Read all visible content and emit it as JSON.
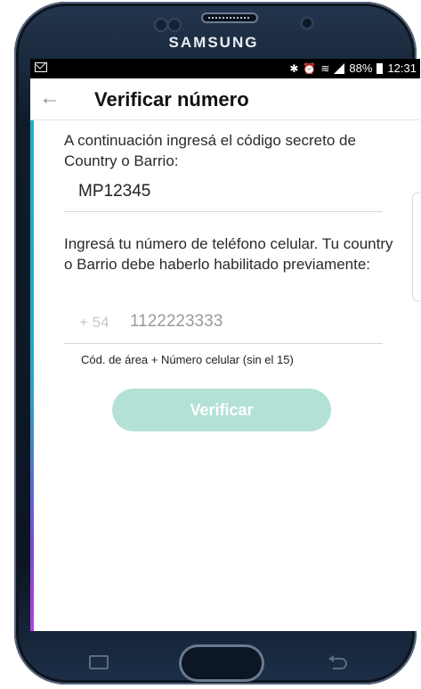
{
  "device": {
    "brand": "SAMSUNG"
  },
  "status_bar": {
    "battery": "88%",
    "time": "12:31"
  },
  "app_bar": {
    "title": "Verificar número",
    "back_icon": "arrow-left-icon"
  },
  "form": {
    "code_prompt": "A continuación ingresá el código secreto de Country o Barrio:",
    "code_value": "MP12345",
    "phone_prompt": "Ingresá tu número de teléfono celular. Tu country o Barrio debe haberlo habilitado previamente:",
    "phone_prefix": "+ 54",
    "phone_placeholder": "1122223333",
    "phone_hint": "Cód. de área + Número celular (sin el 15)",
    "submit_label": "Verificar"
  },
  "colors": {
    "accent_disabled": "#b4e1d6",
    "status_bar": "#000000"
  }
}
